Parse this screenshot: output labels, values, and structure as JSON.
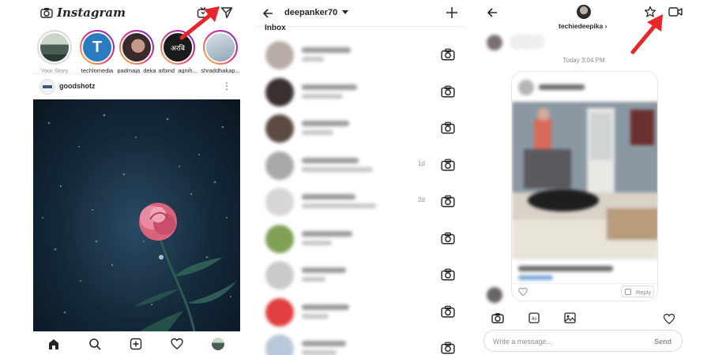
{
  "feed": {
    "app_title": "Instagram",
    "stories": [
      {
        "name": "Your Story"
      },
      {
        "name": "techlomedia"
      },
      {
        "name": "padmaja_deka"
      },
      {
        "name": "arbind_agnih..."
      },
      {
        "name": "shraddhakap..."
      }
    ],
    "story_badge_text": "अरबि",
    "post": {
      "username": "goodshotz",
      "more": "⋮"
    },
    "bottom_nav": [
      "home-icon",
      "search-icon",
      "add-post-icon",
      "heart-icon",
      "profile-icon"
    ]
  },
  "inbox": {
    "username": "deepanker70",
    "section_label": "Inbox",
    "rows": [
      {
        "time": "",
        "avatar_color": "#b8aca6"
      },
      {
        "time": "",
        "avatar_color": "#3a3030"
      },
      {
        "time": "",
        "avatar_color": "#5a4a42"
      },
      {
        "time": "1d",
        "avatar_color": "#a8a8a8"
      },
      {
        "time": "2d",
        "avatar_color": "#d6d6d6"
      },
      {
        "time": "",
        "avatar_color": "#7fa055"
      },
      {
        "time": "",
        "avatar_color": "#c9c9c9"
      },
      {
        "time": "",
        "avatar_color": "#e04040"
      },
      {
        "time": "",
        "avatar_color": "#b7c8d8"
      }
    ]
  },
  "chat": {
    "username": "techiedeepika ›",
    "timestamp": "Today 3:04 PM",
    "message_placeholder": "Write a message...",
    "send_label": "Send",
    "reply_label": "Reply"
  },
  "colors": {
    "annotation_arrow": "#e8262b",
    "story_ring": "#ee2a7b",
    "text_primary": "#262626",
    "text_secondary": "#8e8e8e"
  }
}
